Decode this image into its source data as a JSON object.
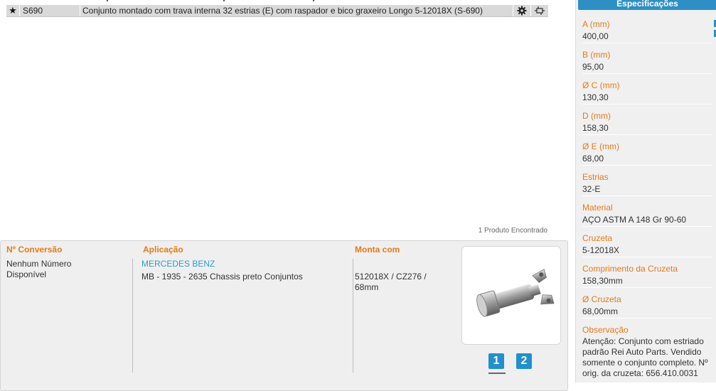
{
  "result": {
    "code": "S690",
    "description": "Conjunto montado com trava interna 32 estrias (E) com raspador e bico graxeiro Longo  5-12018X   (S-690)"
  },
  "found_text": "1 Produto Encontrado",
  "detail": {
    "conversion_header": "Nº Conversão",
    "conversion_text": "Nenhum Número Disponível",
    "application_header": "Aplicação",
    "application_brand": "MERCEDES BENZ",
    "application_text": "MB - 1935 - 2635 Chassis preto   Conjuntos",
    "mount_header": "Monta com",
    "mount_text": "512018X / CZ276 / 68mm",
    "pages": [
      "1",
      "2"
    ]
  },
  "specs": {
    "title": "Especificações",
    "items": [
      {
        "label": "A (mm)",
        "value": "400,00"
      },
      {
        "label": "B (mm)",
        "value": "95,00"
      },
      {
        "label": "Ø C (mm)",
        "value": "130,30"
      },
      {
        "label": "D (mm)",
        "value": "158,30"
      },
      {
        "label": "Ø E (mm)",
        "value": "68,00"
      },
      {
        "label": "Estrias",
        "value": "32-E"
      },
      {
        "label": "Material",
        "value": "AÇO ASTM A 148 Gr 90-60"
      },
      {
        "label": "Cruzeta",
        "value": "5-12018X"
      },
      {
        "label": "Comprimento da Cruzeta",
        "value": "158,30mm"
      },
      {
        "label": "Ø Cruzeta",
        "value": "68,00mm"
      }
    ],
    "observation_label": "Observação",
    "observation_text": "Atenção: Conjunto com estriado padrão Rei Auto Parts.  Vendido somente o conjunto completo. Nº orig. da cruzeta: 656.410.0031"
  },
  "icons": [
    "star-icon",
    "gear-icon",
    "drawing-icon"
  ],
  "colors": {
    "accent_orange": "#e47a1e",
    "accent_blue": "#2d8fc4",
    "row_bg": "#d9d9d9"
  }
}
